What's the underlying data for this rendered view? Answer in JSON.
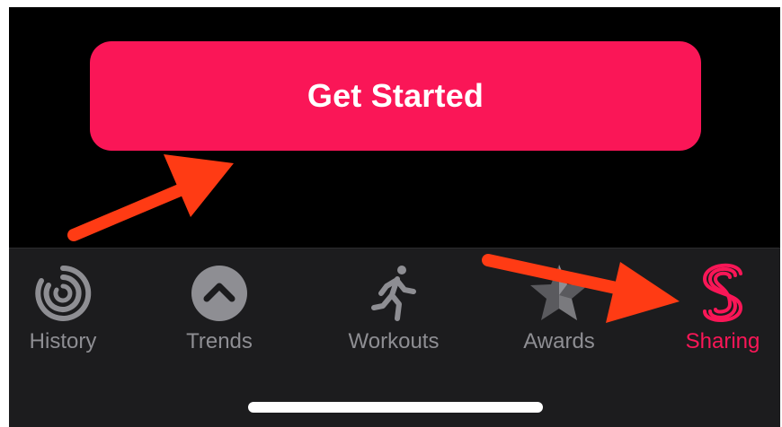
{
  "cta": {
    "label": "Get Started"
  },
  "tabbar": {
    "tabs": [
      {
        "label": "History",
        "icon": "history-rings-icon",
        "active": false
      },
      {
        "label": "Trends",
        "icon": "trends-chevron-up-icon",
        "active": false
      },
      {
        "label": "Workouts",
        "icon": "running-figure-icon",
        "active": false
      },
      {
        "label": "Awards",
        "icon": "star-award-icon",
        "active": false
      },
      {
        "label": "Sharing",
        "icon": "sharing-s-icon",
        "active": true
      }
    ]
  },
  "colors": {
    "accent": "#fa1657",
    "background": "#000000",
    "tabbar": "#1c1c1e",
    "inactive": "#8e8e93",
    "annotation_arrow": "#ff3b14"
  }
}
